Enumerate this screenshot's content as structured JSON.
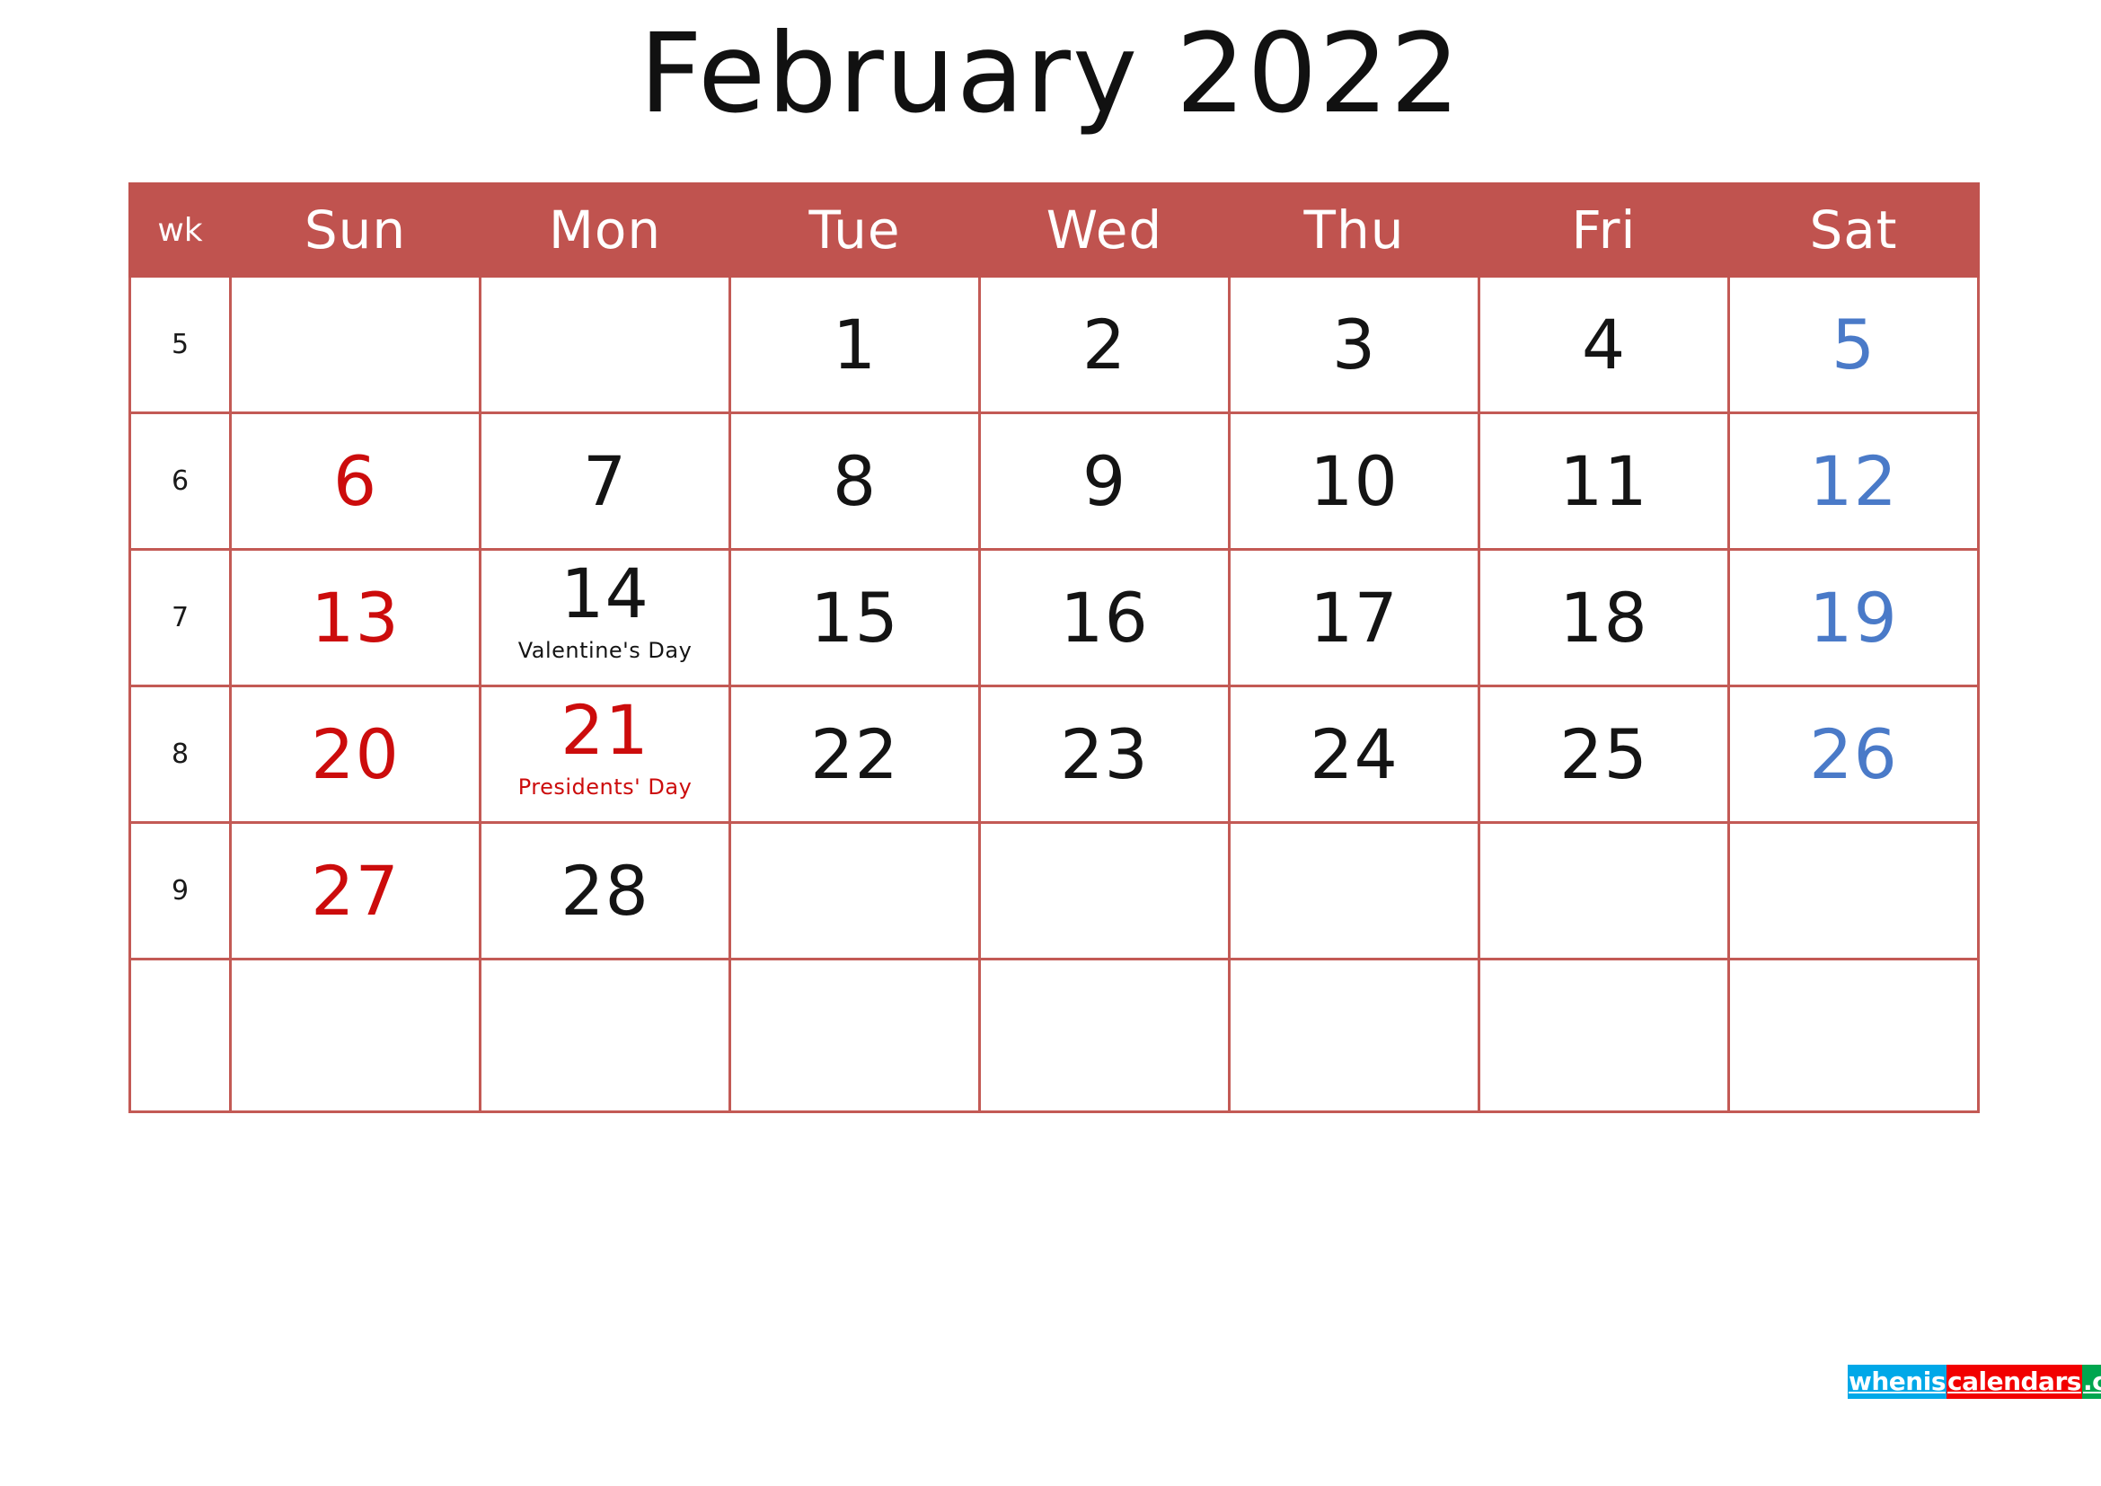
{
  "title": "February 2022",
  "colors": {
    "header_bg": "#C0534F",
    "grid_line": "#C35A55",
    "sunday": "#CC0C0C",
    "saturday": "#4A7AC8",
    "weekday": "#141414",
    "logo_blue": "#00A8E8",
    "logo_red": "#F20000",
    "logo_green": "#00A64F"
  },
  "header": {
    "wk": "wk",
    "days": [
      "Sun",
      "Mon",
      "Tue",
      "Wed",
      "Thu",
      "Fri",
      "Sat"
    ]
  },
  "weeks": [
    {
      "wk": "5",
      "days": [
        {
          "num": "",
          "tone": "sun",
          "event": ""
        },
        {
          "num": "",
          "tone": "weekday",
          "event": ""
        },
        {
          "num": "1",
          "tone": "weekday",
          "event": ""
        },
        {
          "num": "2",
          "tone": "weekday",
          "event": ""
        },
        {
          "num": "3",
          "tone": "weekday",
          "event": ""
        },
        {
          "num": "4",
          "tone": "weekday",
          "event": ""
        },
        {
          "num": "5",
          "tone": "sat",
          "event": ""
        }
      ]
    },
    {
      "wk": "6",
      "days": [
        {
          "num": "6",
          "tone": "sun",
          "event": ""
        },
        {
          "num": "7",
          "tone": "weekday",
          "event": ""
        },
        {
          "num": "8",
          "tone": "weekday",
          "event": ""
        },
        {
          "num": "9",
          "tone": "weekday",
          "event": ""
        },
        {
          "num": "10",
          "tone": "weekday",
          "event": ""
        },
        {
          "num": "11",
          "tone": "weekday",
          "event": ""
        },
        {
          "num": "12",
          "tone": "sat",
          "event": ""
        }
      ]
    },
    {
      "wk": "7",
      "days": [
        {
          "num": "13",
          "tone": "sun",
          "event": ""
        },
        {
          "num": "14",
          "tone": "weekday",
          "event": "Valentine's Day",
          "event_tone": "weekday"
        },
        {
          "num": "15",
          "tone": "weekday",
          "event": ""
        },
        {
          "num": "16",
          "tone": "weekday",
          "event": ""
        },
        {
          "num": "17",
          "tone": "weekday",
          "event": ""
        },
        {
          "num": "18",
          "tone": "weekday",
          "event": ""
        },
        {
          "num": "19",
          "tone": "sat",
          "event": ""
        }
      ]
    },
    {
      "wk": "8",
      "days": [
        {
          "num": "20",
          "tone": "sun",
          "event": ""
        },
        {
          "num": "21",
          "tone": "holiday",
          "event": "Presidents' Day",
          "event_tone": "holiday"
        },
        {
          "num": "22",
          "tone": "weekday",
          "event": ""
        },
        {
          "num": "23",
          "tone": "weekday",
          "event": ""
        },
        {
          "num": "24",
          "tone": "weekday",
          "event": ""
        },
        {
          "num": "25",
          "tone": "weekday",
          "event": ""
        },
        {
          "num": "26",
          "tone": "sat",
          "event": ""
        }
      ]
    },
    {
      "wk": "9",
      "days": [
        {
          "num": "27",
          "tone": "sun",
          "event": ""
        },
        {
          "num": "28",
          "tone": "weekday",
          "event": ""
        },
        {
          "num": "",
          "tone": "weekday",
          "event": ""
        },
        {
          "num": "",
          "tone": "weekday",
          "event": ""
        },
        {
          "num": "",
          "tone": "weekday",
          "event": ""
        },
        {
          "num": "",
          "tone": "weekday",
          "event": ""
        },
        {
          "num": "",
          "tone": "sat",
          "event": ""
        }
      ]
    },
    {
      "wk": "",
      "days": [
        {
          "num": "",
          "tone": "sun",
          "event": ""
        },
        {
          "num": "",
          "tone": "weekday",
          "event": ""
        },
        {
          "num": "",
          "tone": "weekday",
          "event": ""
        },
        {
          "num": "",
          "tone": "weekday",
          "event": ""
        },
        {
          "num": "",
          "tone": "weekday",
          "event": ""
        },
        {
          "num": "",
          "tone": "weekday",
          "event": ""
        },
        {
          "num": "",
          "tone": "sat",
          "event": ""
        }
      ]
    }
  ],
  "logo": {
    "part1": "whenis",
    "part2": "calendars",
    "part3": ".com"
  }
}
